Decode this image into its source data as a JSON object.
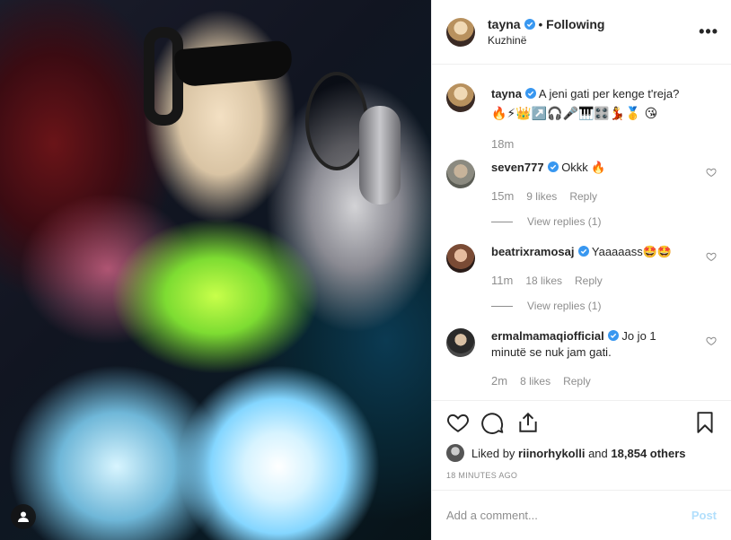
{
  "header": {
    "username": "tayna",
    "separator": "•",
    "follow_state": "Following",
    "location": "Kuzhinë",
    "more_label": "•••"
  },
  "caption": {
    "username": "tayna",
    "text": "A jeni gati per kenge t'reja?",
    "emojis": "🔥⚡👑↗️🎧🎤🎹🎛️💃🥇 😘",
    "time": "18m"
  },
  "comments": [
    {
      "username": "seven777",
      "text": "Okkk 🔥",
      "time": "15m",
      "likes": "9 likes",
      "reply": "Reply",
      "view_replies": "View replies (1)"
    },
    {
      "username": "beatrixramosaj",
      "text": "Yaaaaass🤩🤩",
      "time": "11m",
      "likes": "18 likes",
      "reply": "Reply",
      "view_replies": "View replies (1)"
    },
    {
      "username": "ermalmamaqiofficial",
      "text": "Jo jo 1 minutë se nuk jam gati.",
      "time": "2m",
      "likes": "8 likes",
      "reply": "Reply"
    }
  ],
  "likes": {
    "prefix": "Liked by",
    "user": "riinorhykolli",
    "connector": "and",
    "count": "18,854 others"
  },
  "timestamp": "18 MINUTES AGO",
  "add_comment": {
    "placeholder": "Add a comment...",
    "post_label": "Post"
  },
  "colors": {
    "verified": "#3897f0",
    "muted": "#8e8e8e",
    "post_disabled": "#b2dffc"
  }
}
